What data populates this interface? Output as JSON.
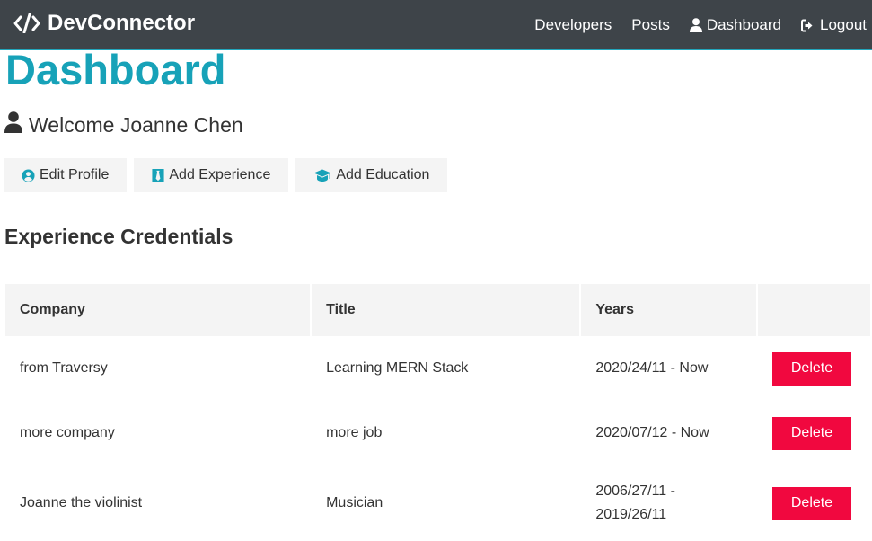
{
  "navbar": {
    "brand": "DevConnector",
    "links": [
      {
        "label": "Developers"
      },
      {
        "label": "Posts"
      },
      {
        "label": "Dashboard",
        "icon": "user-icon"
      },
      {
        "label": "Logout",
        "icon": "sign-out-icon"
      }
    ]
  },
  "page": {
    "title": "Dashboard",
    "welcome": "Welcome Joanne Chen"
  },
  "actions": {
    "edit_profile": "Edit Profile",
    "add_experience": "Add Experience",
    "add_education": "Add Education"
  },
  "experience": {
    "heading": "Experience Credentials",
    "columns": [
      "Company",
      "Title",
      "Years",
      ""
    ],
    "rows": [
      {
        "company": "from Traversy",
        "title": "Learning MERN Stack",
        "years": "2020/24/11 - Now",
        "action": "Delete"
      },
      {
        "company": "more company",
        "title": "more job",
        "years": "2020/07/12 - Now",
        "action": "Delete"
      },
      {
        "company": "Joanne the violinist",
        "title": "Musician",
        "years_line1": "2006/27/11 -",
        "years_line2": "2019/26/11",
        "action": "Delete"
      }
    ]
  },
  "colors": {
    "navbar_bg": "#343a40",
    "primary": "#17a2b8",
    "light": "#f4f4f4",
    "danger": "#f1083f"
  }
}
